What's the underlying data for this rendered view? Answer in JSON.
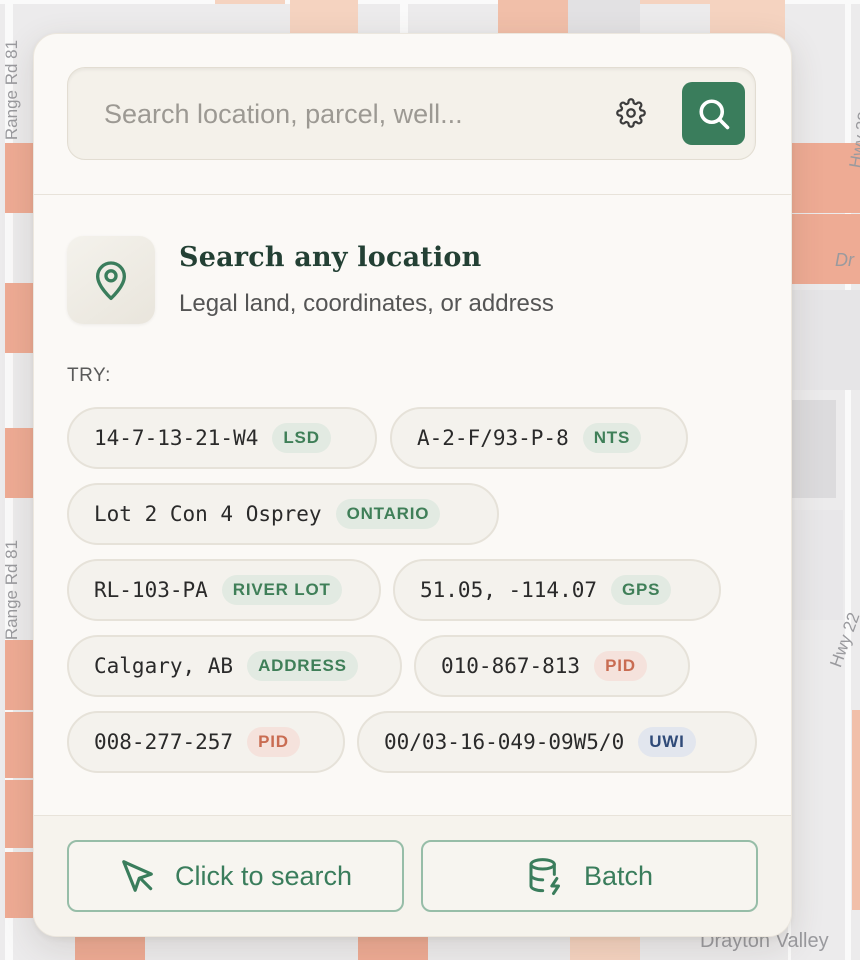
{
  "map": {
    "labels": [
      "Range Rd 81",
      "Range Rd 81",
      "Hwy 22",
      "Hwy 22",
      "Dr",
      "Drayton Valley"
    ]
  },
  "search": {
    "placeholder": "Search location, parcel, well...",
    "value": ""
  },
  "icons": {
    "settings": "gear-icon",
    "search": "search-icon",
    "hero": "map-pin-icon",
    "click_to_search": "cursor-arrow-icon",
    "batch": "database-lightning-icon"
  },
  "hero": {
    "title": "Search any location",
    "subtitle": "Legal land, coordinates, or address"
  },
  "try_label": "TRY:",
  "examples": [
    {
      "text": "14-7-13-21-W4",
      "badge": "LSD"
    },
    {
      "text": "A-2-F/93-P-8",
      "badge": "NTS"
    },
    {
      "text": "Lot 2 Con 4 Osprey",
      "badge": "ONTARIO"
    },
    {
      "text": "RL-103-PA",
      "badge": "RIVER LOT"
    },
    {
      "text": "51.05, -114.07",
      "badge": "GPS"
    },
    {
      "text": "Calgary, AB",
      "badge": "ADDRESS"
    },
    {
      "text": "010-867-813",
      "badge": "PID"
    },
    {
      "text": "008-277-257",
      "badge": "PID"
    },
    {
      "text": "00/03-16-049-09W5/0",
      "badge": "UWI"
    }
  ],
  "footer": {
    "click_to_search": "Click to search",
    "batch": "Batch"
  },
  "colors": {
    "accent": "#3a7d5c",
    "badge_green": "#3f7f58",
    "badge_red": "#c96c52",
    "badge_blue": "#2f4a78",
    "parcel": "#eeab94"
  }
}
